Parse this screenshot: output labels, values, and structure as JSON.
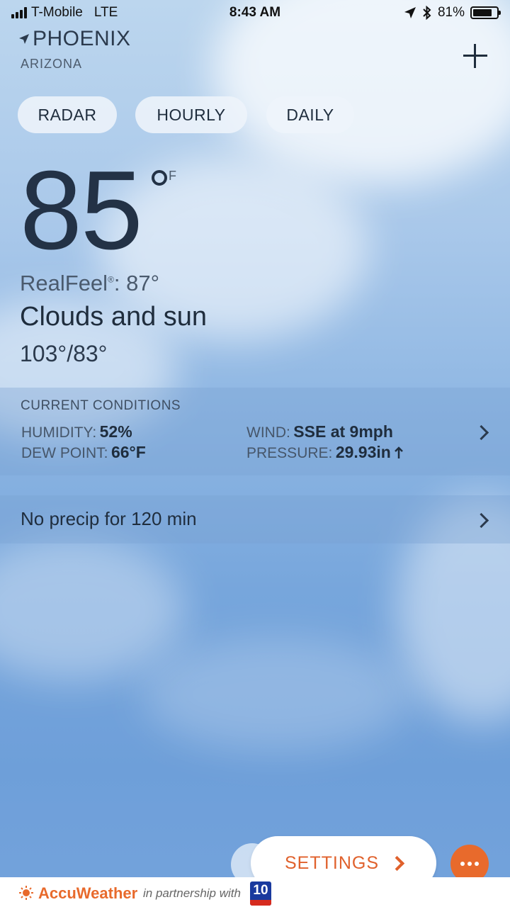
{
  "status_bar": {
    "carrier": "T-Mobile",
    "network": "LTE",
    "time": "8:43 AM",
    "battery_percent": "81%",
    "battery_level": 0.81
  },
  "location": {
    "city": "PHOENIX",
    "state": "ARIZONA"
  },
  "tabs": [
    {
      "label": "RADAR"
    },
    {
      "label": "HOURLY"
    },
    {
      "label": "DAILY"
    }
  ],
  "current": {
    "temperature": "85",
    "unit": "F",
    "realfeel_label": "RealFeel",
    "realfeel_mark": "®",
    "realfeel_value": ": 87°",
    "phrase": "Clouds and sun",
    "hi_lo": "103°/83°"
  },
  "conditions": {
    "title": "CURRENT CONDITIONS",
    "humidity_label": "HUMIDITY:",
    "humidity_value": "52%",
    "dew_point_label": "DEW POINT:",
    "dew_point_value": "66°F",
    "wind_label": "WIND:",
    "wind_value": "SSE at 9mph",
    "pressure_label": "PRESSURE:",
    "pressure_value": "29.93in"
  },
  "precip": {
    "text": "No precip for 120 min"
  },
  "actions": {
    "settings_label": "SETTINGS"
  },
  "footer": {
    "brand": "AccuWeather",
    "partner_text": "in partnership with",
    "partner_logo_text": "10"
  },
  "colors": {
    "accent": "#e86a2c",
    "text_dark": "#1f2d3d",
    "sky_top": "#bcd6ee",
    "sky_bottom": "#6e9fd9"
  },
  "icons": {
    "location": "location-arrow-icon",
    "add": "plus-icon",
    "chevron": "chevron-right-icon",
    "pressure_trend": "arrow-up-icon",
    "more": "ellipsis-icon",
    "bluetooth": "bluetooth-icon"
  }
}
